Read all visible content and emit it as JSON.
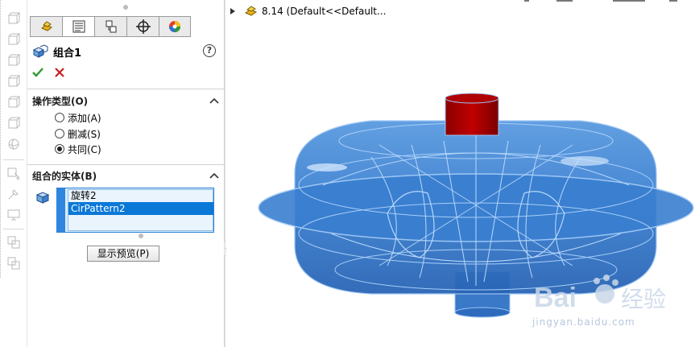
{
  "feature": {
    "title": "组合1",
    "help_glyph": "?"
  },
  "tabs": [
    {
      "name": "feature-manager",
      "icon": "feature-manager-icon"
    },
    {
      "name": "property-manager",
      "icon": "property-manager-icon"
    },
    {
      "name": "configuration-manager",
      "icon": "configuration-manager-icon"
    },
    {
      "name": "dimxpert-manager",
      "icon": "dimxpert-icon"
    },
    {
      "name": "display-manager",
      "icon": "display-manager-icon"
    }
  ],
  "operation_type": {
    "header": "操作类型(O)",
    "options": [
      {
        "label": "添加(A)",
        "checked": false
      },
      {
        "label": "删减(S)",
        "checked": false
      },
      {
        "label": "共同(C)",
        "checked": true
      }
    ]
  },
  "bodies": {
    "header": "组合的实体(B)",
    "items": [
      {
        "label": "旋转2",
        "selected": false
      },
      {
        "label": "CirPattern2",
        "selected": true
      }
    ]
  },
  "preview_button": "显示预览(P)",
  "tree": {
    "part_label": "8.14  (Default<<Default..."
  },
  "watermark": {
    "brand": "Baidu 经验",
    "url": "jingyan.baidu.com"
  },
  "colors": {
    "accent_blue": "#2f86e0",
    "selection_blue": "#0a78d7",
    "model_blue": "#3a7fd0",
    "model_red": "#b00000",
    "ok_green": "#2e9a2e",
    "cancel_red": "#c81e1e"
  }
}
